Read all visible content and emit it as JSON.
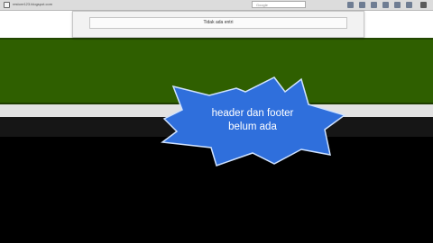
{
  "browser": {
    "url": "restore123.blogspot.com",
    "search_placeholder": "Google"
  },
  "notification": {
    "message": "Tidak ada entri"
  },
  "callout": {
    "line1": "header dan footer",
    "line2": "belum ada",
    "fill_color": "#2f6fdc"
  },
  "colors": {
    "header_band": "#2f5f00",
    "background": "#000000"
  }
}
